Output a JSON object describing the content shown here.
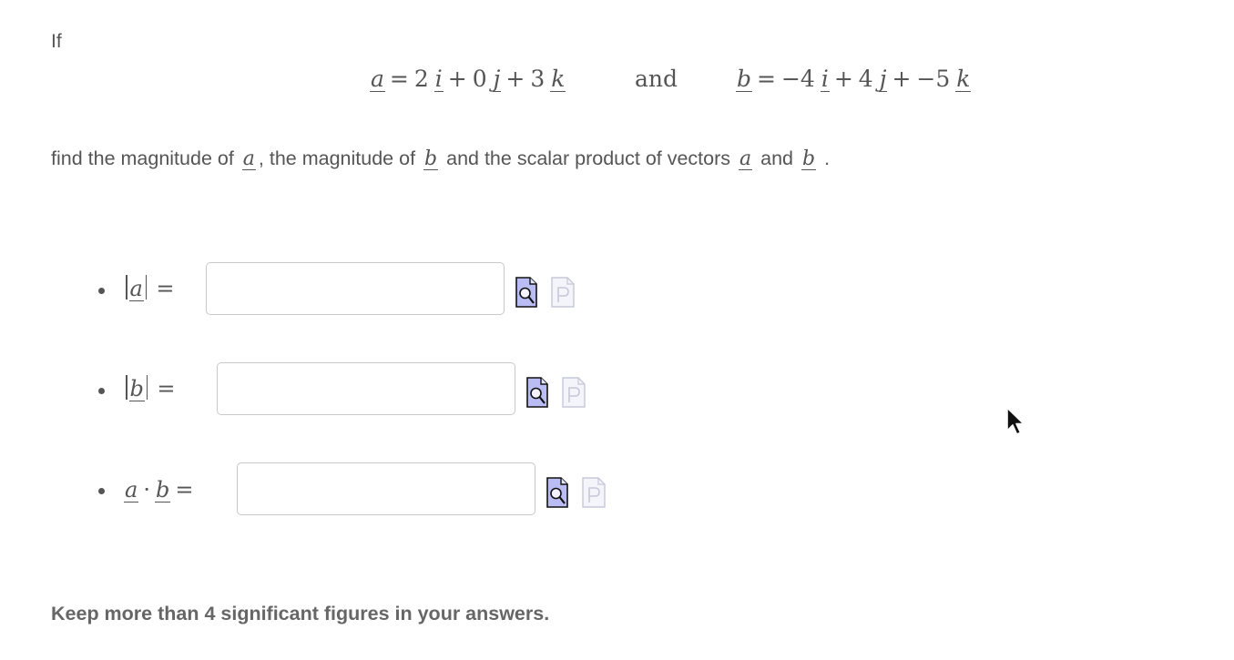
{
  "intro": "If",
  "vector_a": {
    "name": "a",
    "terms": [
      {
        "coef": "2",
        "unit": "i"
      },
      {
        "op": "+",
        "coef": "0",
        "unit": "j"
      },
      {
        "op": "+",
        "coef": "3",
        "unit": "k"
      }
    ]
  },
  "connector": "and",
  "vector_b": {
    "name": "b",
    "terms": [
      {
        "coef": "−4",
        "unit": "i"
      },
      {
        "op": "+",
        "coef": "4",
        "unit": "j"
      },
      {
        "op": "+",
        "coef": "−5",
        "unit": "k"
      }
    ]
  },
  "equals": "=",
  "instruction": {
    "part1": "find  the magnitude of",
    "part2": ", the magnitude of",
    "part3": "and the scalar product of vectors",
    "part4": "and",
    "part5": ".",
    "v1": "a",
    "v2": "b"
  },
  "questions": [
    {
      "label_var": "a",
      "value": "",
      "placeholder": ""
    },
    {
      "label_var": "b",
      "value": "",
      "placeholder": ""
    },
    {
      "label_var1": "a",
      "dot": "·",
      "label_var2": "b",
      "value": "",
      "placeholder": ""
    }
  ],
  "icons": {
    "preview": "preview-magnifier-icon",
    "paste": "p-document-icon"
  },
  "note": "Keep more than 4 significant figures in your answers."
}
